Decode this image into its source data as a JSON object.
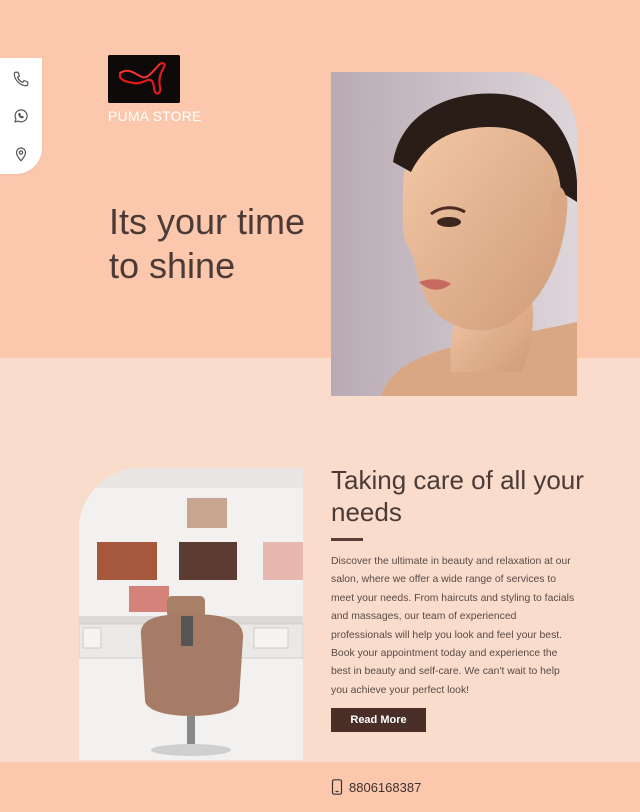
{
  "brand": {
    "store_name": "PUMA STORE"
  },
  "side_dock": {
    "icons": [
      "phone-icon",
      "whatsapp-icon",
      "location-pin-icon"
    ]
  },
  "hero": {
    "headline": "Its your time to shine"
  },
  "about": {
    "title": "Taking care of all your needs",
    "body": "Discover the ultimate in beauty and relaxation at our salon, where we offer a wide range of services to meet your needs. From haircuts and styling to facials and massages, our team of experienced professionals will help you look and feel your best. Book your appointment today and experience the best in beauty and self-care. We can't wait to help you achieve your perfect look!",
    "cta_label": "Read More"
  },
  "footer": {
    "phone": "8806168387"
  },
  "colors": {
    "hero_bg": "#fbc8ae",
    "section_bg": "#f9dccc",
    "text_dark": "#4b3a36",
    "button_bg": "#4a2f29"
  }
}
